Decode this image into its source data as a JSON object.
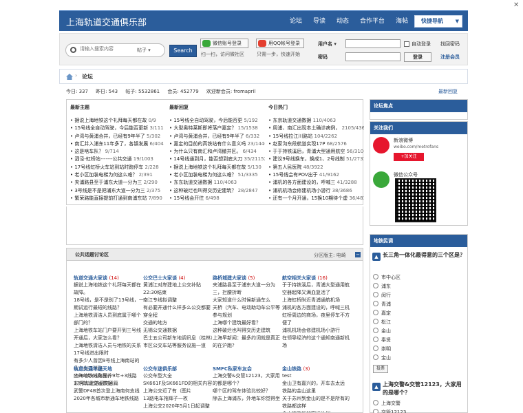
{
  "header": {
    "logo": "上海轨道交通俱乐部",
    "nav": [
      "论坛",
      "导读",
      "动态",
      "合作平台",
      "海帖"
    ],
    "quick_nav": "快捷导航"
  },
  "searchbar": {
    "placeholder": "请输入搜索内容",
    "scope": "帖子",
    "search_button": "Search",
    "wechat_login": "微信账号登录",
    "wechat_sub": "扫一扫，访问微社区",
    "qq_login": "用QQ帐号登录",
    "qq_sub": "只需一步，快速开始",
    "username_label": "用户名",
    "password_label": "密码",
    "auto_login": "自动登录",
    "forgot": "找回密码",
    "register": "注册会员"
  },
  "breadcrumb": {
    "current": "论坛"
  },
  "stats": {
    "today": "今日: 337",
    "yesterday": "昨日: 543",
    "posts": "帖子: 5532861",
    "members": "会员: 452779",
    "newest": "欢迎新会员: fromapril",
    "latest_reply": "最新回复"
  },
  "columns": [
    {
      "title": "最新主题",
      "items": [
        {
          "t": "据说上海地铁这个礼拜每天都在故",
          "n": "0/9"
        },
        {
          "t": "15号线全自动驾驶，今后能否更新",
          "n": "3/111"
        },
        {
          "t": "卢湾与黄浦合并，已经有9年半了",
          "n": "5/302"
        },
        {
          "t": "南汇并入浦东11年多了，各镇发展",
          "n": "6/404"
        },
        {
          "t": "这是啥车队？",
          "n": "9/714"
        },
        {
          "t": "泗泾-虹桥站-------公共交通",
          "n": "19/1003"
        },
        {
          "t": "17号线虹桥火车站到站时跑停车",
          "n": "2/228"
        },
        {
          "t": "老小区加装电梯为何这么难？",
          "n": "2/391"
        },
        {
          "t": "夹浦路县至于浦东大道一分为三",
          "n": "2/290"
        },
        {
          "t": "3号线是不是把浦东大道一分为三",
          "n": "2/375"
        },
        {
          "t": "繁荣路能直接提前打通到南浦东站",
          "n": "7/890"
        }
      ]
    },
    {
      "title": "最新回复",
      "items": [
        {
          "t": "15号线全自动驾驶，今后能否更",
          "n": "5/192"
        },
        {
          "t": "大型奥特莱斯即将落户嘉定？",
          "n": "15/1538"
        },
        {
          "t": "卢湾与黄浦合并，已经有9年半了",
          "n": "6/332"
        },
        {
          "t": "嘉定的目前的高铁站有什么意义吗",
          "n": "23/1440"
        },
        {
          "t": "为什么只有南汇和卢湾撤并区。",
          "n": "6/434"
        },
        {
          "t": "14号线通到月，能否想到底大刀",
          "n": "35/21152"
        },
        {
          "t": "据说上海地铁这个礼拜每天都在故",
          "n": "5/130"
        },
        {
          "t": "老小区加装电梯为何这么难？",
          "n": "51/3335"
        },
        {
          "t": "东东轨道交通数据",
          "n": "110/4063"
        },
        {
          "t": "这种破烂也叫得交历史建筑？",
          "n": "28/2847"
        },
        {
          "t": "15号线会开往",
          "n": "6/498"
        }
      ]
    },
    {
      "title": "今日热门",
      "items": [
        {
          "t": "东京轨道交通数据",
          "n": "110/4063"
        },
        {
          "t": "周浦、南汇出现本土确诊病例，",
          "n": "2105/43626"
        },
        {
          "t": "15号线拉江川路站",
          "n": "104/2262"
        },
        {
          "t": "赵家沟东段航道实现17P",
          "n": "68/2576"
        },
        {
          "t": "于于持铁溪后，青浦大型通用航空",
          "n": "56/3106"
        },
        {
          "t": "建议9号线换车，换成1、2号线制",
          "n": "51/2731"
        },
        {
          "t": "第五人民医院",
          "n": "48/3922"
        },
        {
          "t": "15号线会有POV出于",
          "n": "41/9162"
        },
        {
          "t": "浦机的各方面建设的，呼喊三",
          "n": "41/3288"
        },
        {
          "t": "浦机机场会修建机场小游行",
          "n": "38/3686"
        },
        {
          "t": "还有一个月开通，15换10期待个虚",
          "n": "36/4819"
        }
      ]
    }
  ],
  "public": {
    "title": "公共话题讨论区",
    "moderator": "分区版主: 电崎",
    "forums": [
      {
        "name": "轨道交通大家谈",
        "count": "(14)",
        "posts": [
          "据说上海地铁这个礼拜每天都在故障。",
          "18号线，是不是别了13号线，一期试运行最短的线路？",
          "上海地铁清洁人员到底属于哪个部门的？",
          "上海地铁车站门户要开到三号线开通后，大家怎么看？",
          "上海地铁清洁人员与地铁的关系",
          "17号线进出限时",
          "有多少人曾因9号线上海南站的几个出口迷路",
          "上海地铁线路图，9年+3线路",
          "东京轨道交通数据"
        ]
      },
      {
        "name": "公交巴士大家谈",
        "count": "(4)",
        "posts": [
          "黄浦江对岸建地上公交补贴22:30结束",
          "南江专线拟调整",
          "有必要开通什么样多么公交都要穿全程",
          "交通的地方",
          "无锡公交通数据",
          "巴士五公司新车地调讯息（桂林）",
          "市区公交车站等服务设施一道"
        ]
      },
      {
        "name": "路桥城建大家谈",
        "count": "(5)",
        "posts": [
          "夹浦路县至于浦东大道一分为三，拦腰折断",
          "大家知道什么时候新通车么",
          "天桥（汽车、电动助动车公平等参与规划",
          "上海哪个建筑最好看？",
          "这种破烂也叫得交历史建筑",
          "上海早新闻：最多约词就是真正的在沪跑?"
        ]
      },
      {
        "name": "航空相关大家谈",
        "count": "(16)",
        "posts": [
          "于于持铁溪后，青浦大型通用航空器起降又满血复活了",
          "上海虹桥附近青浦通航机场",
          "浦机的各方面建设的，呼喊三机",
          "虹桥周边的商场，夜里停车不方便了",
          "浦机机场会修建机场小游行",
          "在领导经济的这个通知南通新机场"
        ]
      }
    ],
    "forums2": [
      {
        "name": "轨道交通车迷天地",
        "count": "",
        "posts": [
          "Metrofans车保养",
          "17号车北游记交通篇",
          "武警DF4B首次登上海南何支线",
          "2020年各城市新通车地铁线路"
        ]
      },
      {
        "name": "公交车迷俱乐部",
        "count": "",
        "posts": [
          "公交车型大全",
          "SK661F及SK661FD的相关内容",
          "上海公交近了有（图片",
          "13路电车拖辉子一枚",
          "上海公交2020年5月1日起调整"
        ]
      },
      {
        "name": "SMFC私家车友会",
        "count": "",
        "posts": [
          "上海交警&交管12123，大家用的都是哪个？",
          "哪个区的驾车体验比较好？",
          "除去上海浦东，外地车你觉得坐"
        ]
      },
      {
        "name": "金山铁路",
        "count": "(3)",
        "posts": [
          "test",
          "金山卫有嘉兴的，开车去太远",
          "铁路的金山这里",
          "关于苏州到金山的是不是所有的铁路都这样",
          "金山铁路新的客运计划"
        ]
      }
    ]
  },
  "sidebar": {
    "focus_title": "论坛焦点",
    "follow_title": "关注我们",
    "weibo_name": "新浪微博",
    "weibo_url": "weibo.com/metrofans",
    "weibo_follow": "+加关注",
    "wechat_name": "微信公众号",
    "poll_title": "地铁民调",
    "poll1_q": "长三角一体化最得意的三个区是？",
    "poll1_opts": [
      "市中心区",
      "浦东",
      "闵行",
      "青浦",
      "嘉定",
      "松江",
      "金山",
      "奉贤",
      "崇明",
      "宝山"
    ],
    "poll1_btn": "投票",
    "poll2_q": "上海交警&交管12123，大家用的是哪个？",
    "poll2_opts": [
      "上海交警",
      "交管12123"
    ]
  }
}
